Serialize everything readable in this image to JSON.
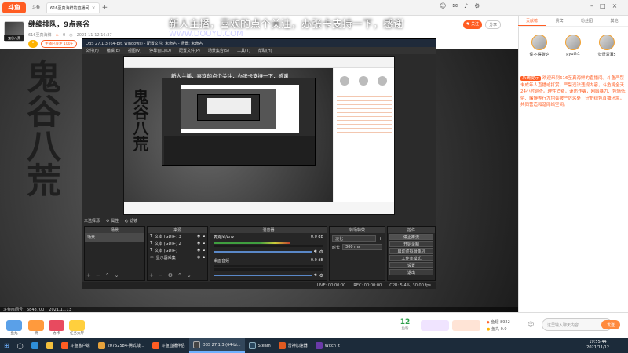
{
  "browser": {
    "tabs": [
      {
        "label": "斗鱼",
        "active": false
      },
      {
        "label": "616至真海鲜的直播间",
        "active": true
      }
    ]
  },
  "room": {
    "avatar_tag": "鬼谷八荒",
    "title": "继续排队，9点亲谷",
    "owner": "616至真海鲜",
    "heat": "0",
    "time": "2021-11-12 16:37",
    "badge": "主播已关注 100+"
  },
  "overlay": {
    "main_text": "新人主播，喜欢的点个关注，办张卡支持一下，感谢",
    "calligraphy": "鬼谷八荒",
    "footer_room": "斗鱼房间号：6848700",
    "footer_date": "2021.11.13"
  },
  "obs": {
    "title": "OBS 27.1.3 (64-bit, windows) - 配置文件: 未命名 - 场景: 未命名",
    "menu": [
      "文件(F)",
      "编辑(E)",
      "视图(V)",
      "停靠窗口(D)",
      "配置文件(P)",
      "场景集合(S)",
      "工具(T)",
      "帮助(H)"
    ],
    "source_toolbar": [
      "属性",
      "滤镜"
    ],
    "source_label": "未选择源",
    "panels": {
      "scenes": "场景",
      "sources": "来源",
      "mixer": "混音器",
      "transitions": "转场特效",
      "controls": "控件"
    },
    "scenes_list": [
      "场景"
    ],
    "sources_list": [
      "文本 (GDI+) 3",
      "文本 (GDI+) 2",
      "文本 (GDI+)",
      "显示器采集"
    ],
    "mixer_channels": [
      {
        "name": "麦克风/Aux",
        "db": "0.0 dB"
      },
      {
        "name": "桌面音频",
        "db": "0.0 dB"
      }
    ],
    "transition": {
      "type": "淡化",
      "duration_label": "时长",
      "duration": "300 ms"
    },
    "controls": [
      "停止推流",
      "开始录制",
      "启动虚拟摄像机",
      "工作室模式",
      "设置",
      "退出"
    ],
    "status": {
      "live": "LIVE: 00:00:00",
      "rec": "REC: 00:00:00",
      "cpu": "CPU: 5.4%, 30.00 fps"
    }
  },
  "sidebar": {
    "tabs": [
      "贡献榜",
      "贵宾",
      "粉丝团",
      "其他"
    ],
    "ranks": [
      {
        "name": "侯不得碳炉"
      },
      {
        "name": "pyuth1"
      },
      {
        "name": "觉悟清酒5"
      }
    ],
    "notice_label": "系统提示",
    "notice": "欢迎来到616至真海鲜的直播间。斗鱼严禁未成年人直播或打赏，严禁违法违规内容，斗鱼将全天24小时巡查。理性消费，谨防诈骗，网络暴力、色情低俗、赌博等行为均会被严厉惩处，守护绿色直播环境，共同营造和谐网络空间。"
  },
  "bottom": {
    "gifts": [
      "鱼丸",
      "赞",
      "办卡",
      "任务大厅"
    ],
    "level": "12",
    "level_sub": "鱼粉",
    "chat_placeholder": "这里输入聊天内容",
    "send": "发送",
    "stats": [
      {
        "label": "鱼翅",
        "value": "8922"
      },
      {
        "label": "鱼丸",
        "value": "0.0"
      }
    ]
  },
  "taskbar": {
    "items": [
      {
        "label": "斗鱼客户端",
        "color": "#ff5d23",
        "active": false
      },
      {
        "label": "20752584-腾式战...",
        "color": "#e6a23c",
        "active": false
      },
      {
        "label": "斗鱼直播伴侣",
        "color": "#ff5d23",
        "active": false
      },
      {
        "label": "OBS 27.1.3 (64-bi...",
        "color": "#444",
        "active": true
      },
      {
        "label": "Steam",
        "color": "#2a475e",
        "active": false
      },
      {
        "label": "雷神加速器",
        "color": "#e05a20",
        "active": false
      },
      {
        "label": "Witch It",
        "color": "#6a3aa8",
        "active": false
      }
    ],
    "time": "19:55:44",
    "date": "2021/11/12"
  },
  "colors": {
    "brand": "#ff5d23",
    "taskbar": "#1c2b3a",
    "obs_bg": "#2b2b2b"
  }
}
